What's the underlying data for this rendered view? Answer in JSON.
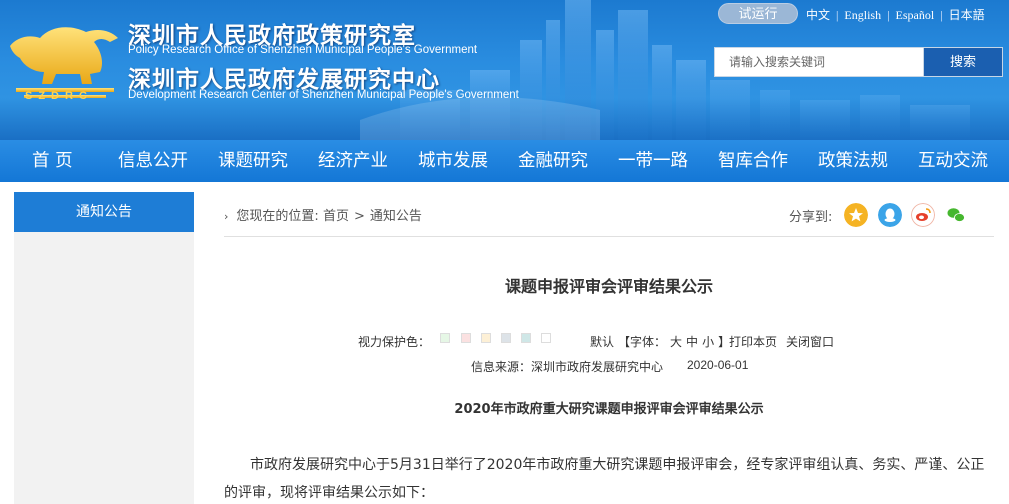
{
  "header": {
    "logo_text": "SZDRC",
    "org1_cn": "深圳市人民政府政策研究室",
    "org1_en": "Policy Research Office of Shenzhen Municipal People's Government",
    "org2_cn": "深圳市人民政府发展研究中心",
    "org2_en": "Development Research Center of Shenzhen Municipal People's Government",
    "trial_label": "试运行",
    "languages": [
      "中文",
      "English",
      "Español",
      "日本語"
    ],
    "search_placeholder": "请输入搜索关键词",
    "search_button": "搜索"
  },
  "nav": {
    "items": [
      "首 页",
      "信息公开",
      "课题研究",
      "经济产业",
      "城市发展",
      "金融研究",
      "一带一路",
      "智库合作",
      "政策法规",
      "互动交流"
    ]
  },
  "sidebar": {
    "title": "通知公告"
  },
  "breadcrumb": {
    "prefix": "您现在的位置:",
    "items": [
      "首页",
      "通知公告"
    ],
    "separator": ">"
  },
  "share": {
    "label": "分享到:",
    "icons": [
      "qzone-icon",
      "qq-icon",
      "weibo-icon",
      "wechat-icon"
    ]
  },
  "article": {
    "title": "课题申报评审会评审结果公示",
    "eye_protect_label": "视力保护色：",
    "swatch_colors": [
      "#e6f7e6",
      "#fbe1e1",
      "#fdf0d6",
      "#dde3e8",
      "#cfe7e7",
      "#ffffff"
    ],
    "default_label": "默认",
    "font_label": "【字体：",
    "font_sizes": [
      "大",
      "中",
      "小"
    ],
    "font_close": "】",
    "print_label": "打印本页",
    "close_label": "关闭窗口",
    "source_label": "信息来源：",
    "source_value": "深圳市政府发展研究中心",
    "date": "2020-06-01",
    "subtitle": "2020年市政府重大研究课题申报评审会评审结果公示",
    "paragraph_line1": "市政府发展研究中心于5月31日举行了2020年市政府重大研究课题申报评审会，经专家评审组认真、务实、严谨、公正",
    "paragraph_line2": "的评审，现将评审结果公示如下："
  }
}
